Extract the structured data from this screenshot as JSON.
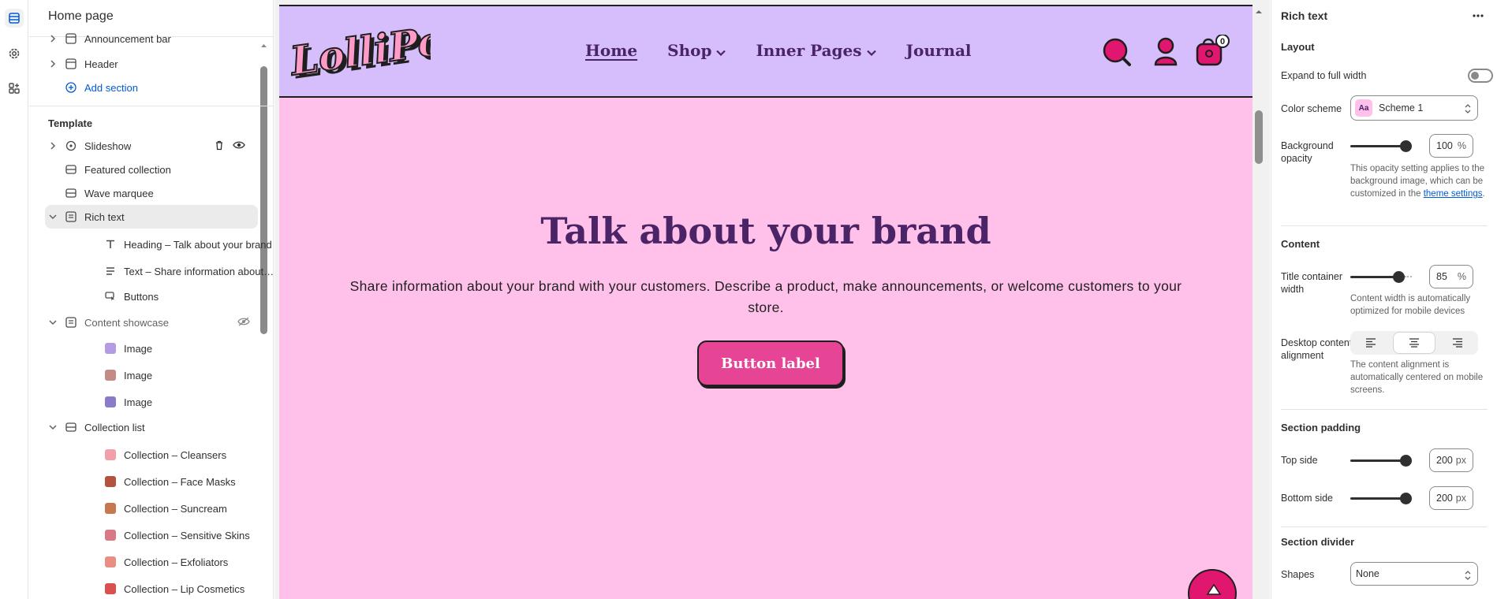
{
  "sidebar": {
    "title": "Home page",
    "header_sections": [
      {
        "label": "Announcement bar"
      },
      {
        "label": "Header"
      }
    ],
    "add_section_label": "Add section",
    "template_title": "Template",
    "sections": [
      {
        "label": "Slideshow"
      },
      {
        "label": "Featured collection"
      },
      {
        "label": "Wave marquee"
      },
      {
        "label": "Rich text"
      },
      {
        "label": "Content showcase"
      },
      {
        "label": "Collection list"
      }
    ],
    "rich_text_blocks": [
      {
        "type": "Heading",
        "detail": "Talk about your brand"
      },
      {
        "type": "Text",
        "detail": "Share information about y..."
      },
      {
        "type": "Buttons",
        "detail": ""
      }
    ],
    "showcase_blocks": [
      {
        "label": "Image",
        "color": "#b59be3"
      },
      {
        "label": "Image",
        "color": "#c48a87"
      },
      {
        "label": "Image",
        "color": "#8b7ac8"
      }
    ],
    "collection_blocks": [
      {
        "type": "Collection",
        "detail": "Cleansers",
        "color": "#f0a0a8"
      },
      {
        "type": "Collection",
        "detail": "Face Masks",
        "color": "#b3523f"
      },
      {
        "type": "Collection",
        "detail": "Suncream",
        "color": "#c6794f"
      },
      {
        "type": "Collection",
        "detail": "Sensitive Skins",
        "color": "#d77a85"
      },
      {
        "type": "Collection",
        "detail": "Exfoliators",
        "color": "#e98e82"
      },
      {
        "type": "Collection",
        "detail": "Lip Cosmetics",
        "color": "#d9504f"
      }
    ],
    "separator": "–"
  },
  "preview": {
    "logo_text": "LolliPop",
    "nav": [
      {
        "label": "Home",
        "current": true
      },
      {
        "label": "Shop",
        "dropdown": true
      },
      {
        "label": "Inner Pages",
        "dropdown": true
      },
      {
        "label": "Journal"
      }
    ],
    "cart_count": "0",
    "heading": "Talk about your brand",
    "text": "Share information about your brand with your customers. Describe a product, make announcements, or welcome customers to your store.",
    "button_label": "Button label",
    "colors": {
      "header_bg": "#d6bdfb",
      "page_bg": "#ffc1ea",
      "heading": "#4a2466",
      "button": "#e64596",
      "icon_accent": "#e0166f"
    }
  },
  "panel": {
    "title": "Rich text",
    "layout_heading": "Layout",
    "expand_label": "Expand to full width",
    "expand_on": false,
    "color_scheme_label": "Color scheme",
    "color_scheme_value": "Scheme 1",
    "color_scheme_swatch": "Aa",
    "bg_opacity_label": "Background opacity",
    "bg_opacity_value": "100",
    "bg_opacity_fraction": 1.0,
    "percent_unit": "%",
    "bg_opacity_help": "This opacity setting applies to the background image, which can be customized in the",
    "bg_opacity_link": "theme settings",
    "content_heading": "Content",
    "title_width_label": "Title container width",
    "title_width_value": "85",
    "title_width_fraction": 0.85,
    "title_width_help": "Content width is automatically optimized for mobile devices",
    "alignment_label": "Desktop content alignment",
    "alignment_value": "center",
    "alignment_help": "The content alignment is automatically centered on mobile screens.",
    "padding_heading": "Section padding",
    "top_label": "Top side",
    "top_value": "200",
    "top_fraction": 1.0,
    "bottom_label": "Bottom side",
    "bottom_value": "200",
    "bottom_fraction": 1.0,
    "px_unit": "px",
    "divider_heading": "Section divider",
    "shapes_label": "Shapes",
    "shapes_value": "None"
  }
}
